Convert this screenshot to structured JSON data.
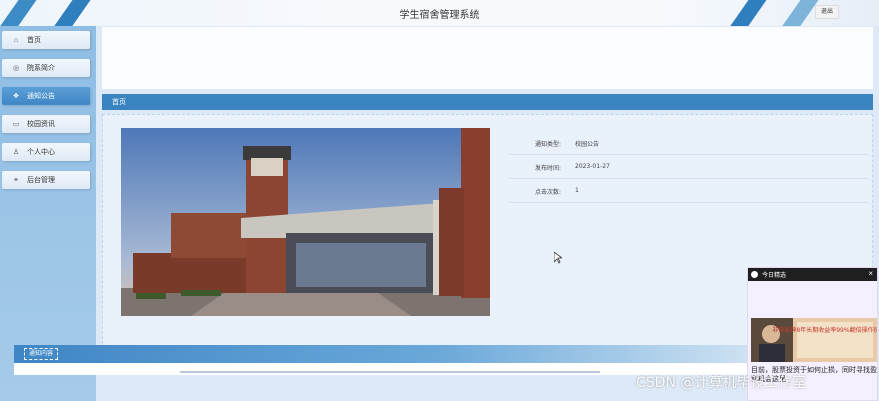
{
  "header": {
    "title": "学生宿舍管理系统",
    "logout_label": "退出"
  },
  "sidebar": {
    "items": [
      {
        "label": "首页",
        "icon": "home-icon"
      },
      {
        "label": "院系简介",
        "icon": "info-icon"
      },
      {
        "label": "通知公告",
        "icon": "notice-icon",
        "active": true
      },
      {
        "label": "校园资讯",
        "icon": "news-icon"
      },
      {
        "label": "个人中心",
        "icon": "user-icon"
      },
      {
        "label": "后台管理",
        "icon": "link-icon"
      }
    ]
  },
  "breadcrumb": {
    "label": "首页"
  },
  "details": [
    {
      "label": "通知类型:",
      "value": "校园公告"
    },
    {
      "label": "发布时间:",
      "value": "2023-01-27"
    },
    {
      "label": "点击次数:",
      "value": "1"
    }
  ],
  "notice": {
    "tag": "通知内容"
  },
  "popup": {
    "title": "今日精选",
    "caption": "目前，股票投资于如何止损，同时寻找盈利机会这里",
    "banner_text": "非常股神8年长期收益率99%翻倍操作技巧揭秘"
  },
  "watermark": "CSDN @计算机毕设工作室",
  "colors": {
    "primary": "#3a84c0",
    "sidebar_bg": "#9ac4e7",
    "active_item": "#4a91cd"
  }
}
